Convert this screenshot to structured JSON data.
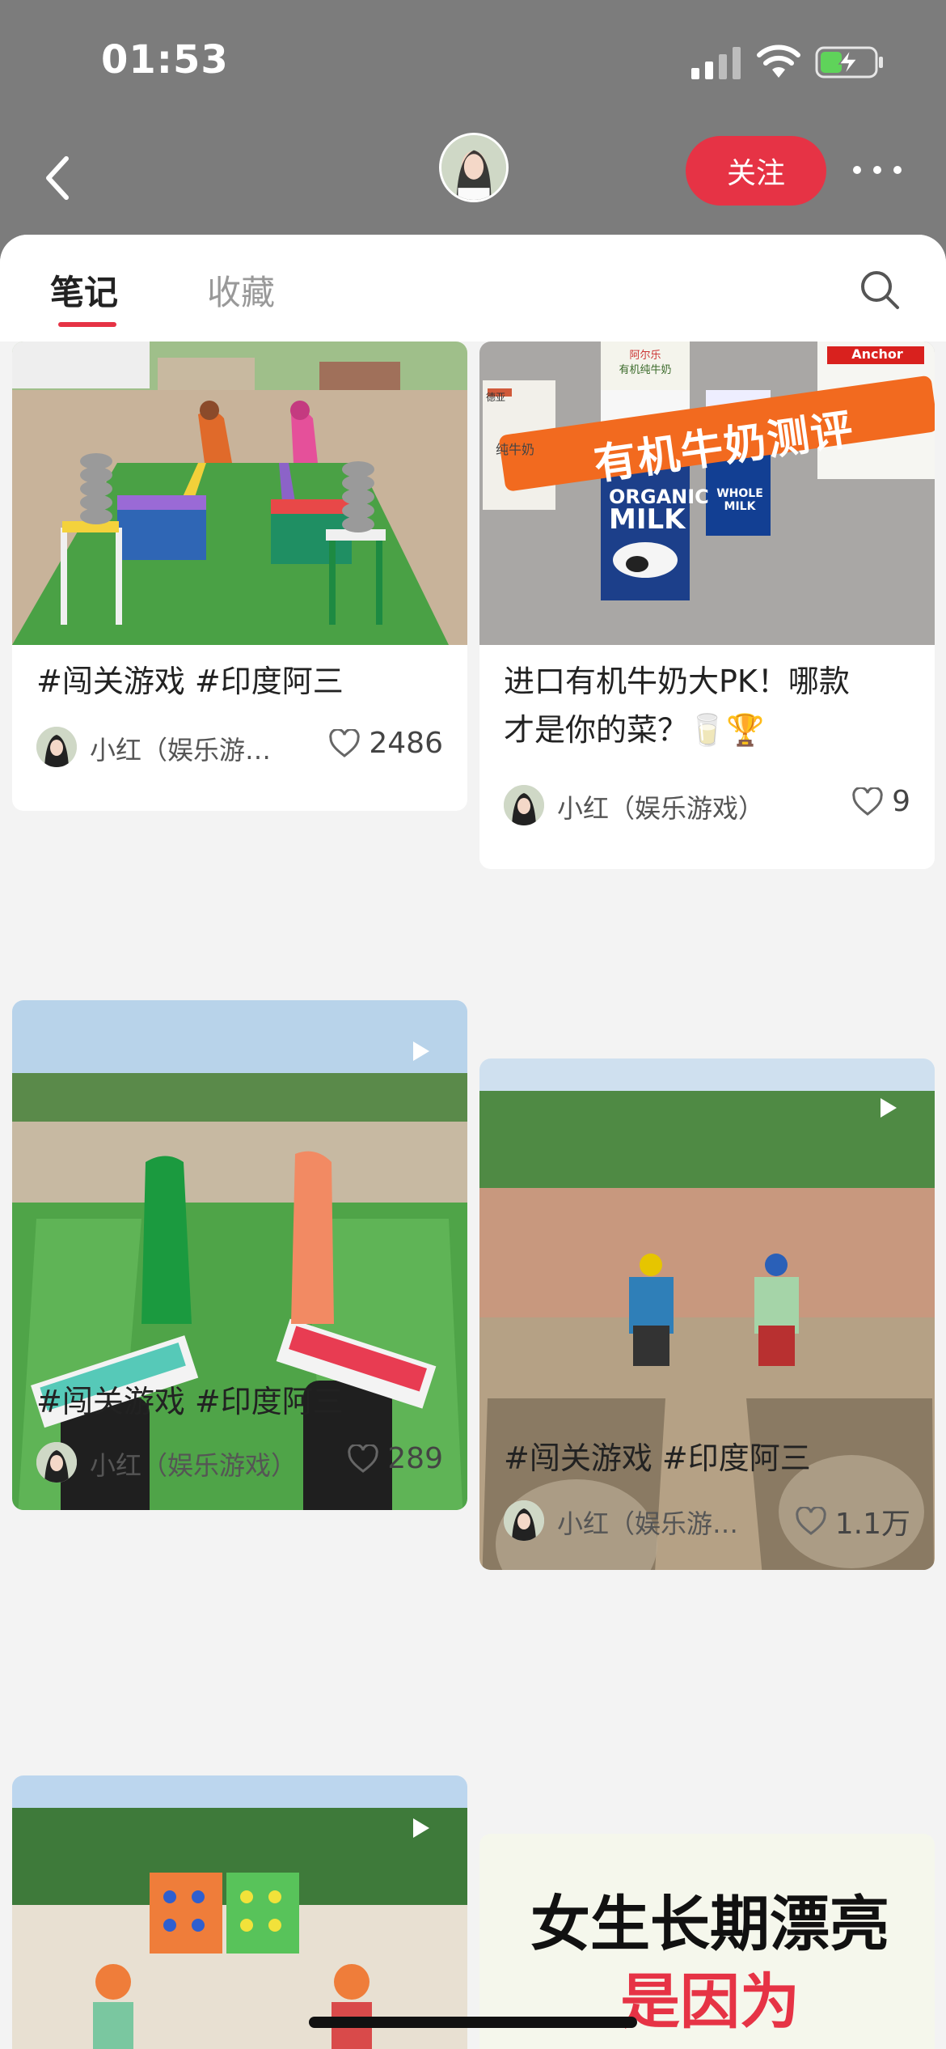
{
  "status": {
    "time": "01:53"
  },
  "nav": {
    "follow_label": "关注"
  },
  "tabs": {
    "notes": "笔记",
    "favorites": "收藏"
  },
  "cards": [
    {
      "title": "#闯关游戏 #印度阿三",
      "author": "小红（娱乐游…",
      "likes": "2486"
    },
    {
      "title_line1": "进口有机牛奶大PK！哪款",
      "title_line2": "才是你的菜？🥛🏆",
      "author": "小红（娱乐游戏）",
      "likes": "9",
      "banner": "有机牛奶测评",
      "milk_labels": [
        "ORGANIC",
        "MILK",
        "WHOLE MILK",
        "Anchor",
        "阿尔乐",
        "有机纯牛奶",
        "德亚",
        "纯牛奶"
      ]
    },
    {
      "title": "#闯关游戏 #印度阿三",
      "author": "小红（娱乐游戏）",
      "likes": "289"
    },
    {
      "title": "#闯关游戏 #印度阿三",
      "author": "小红（娱乐游…",
      "likes": "1.1万"
    },
    {
      "poster_line1": "女生长期漂亮",
      "poster_line2": "是因为"
    }
  ],
  "colors": {
    "accent": "#e63345",
    "grass": "#3f9a3a"
  }
}
